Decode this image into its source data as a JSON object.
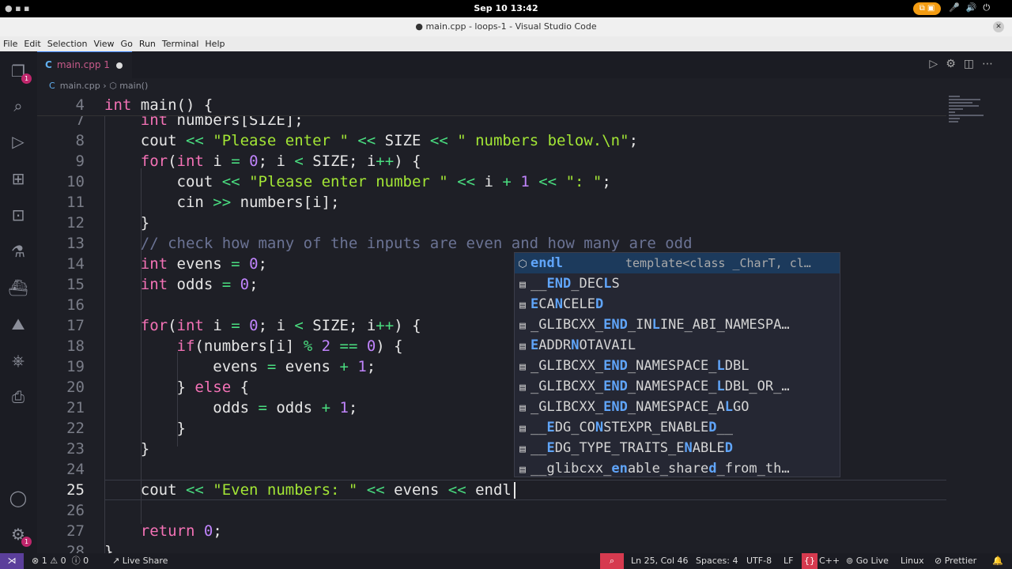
{
  "top_bar": {
    "clock": "Sep 10  13:42"
  },
  "window_title": "● main.cpp - loops-1 - Visual Studio Code",
  "menu": [
    "File",
    "Edit",
    "Selection",
    "View",
    "Go",
    "Run",
    "Terminal",
    "Help"
  ],
  "activity_badges": {
    "explorer": "1",
    "settings": "1"
  },
  "tab": {
    "lang_icon": "C",
    "label": "main.cpp 1"
  },
  "breadcrumb": {
    "file": "main.cpp",
    "symbol": "main()"
  },
  "sticky_line": {
    "number": "4",
    "text": "int main() {"
  },
  "lines": [
    {
      "n": "7",
      "t": "    int numbers[SIZE];"
    },
    {
      "n": "8",
      "t": "    cout << \"Please enter \" << SIZE << \" numbers below.\\n\";"
    },
    {
      "n": "9",
      "t": "    for(int i = 0; i < SIZE; i++) {"
    },
    {
      "n": "10",
      "t": "        cout << \"Please enter number \" << i + 1 << \": \";"
    },
    {
      "n": "11",
      "t": "        cin >> numbers[i];"
    },
    {
      "n": "12",
      "t": "    }"
    },
    {
      "n": "13",
      "t": "    // check how many of the inputs are even and how many are odd"
    },
    {
      "n": "14",
      "t": "    int evens = 0;"
    },
    {
      "n": "15",
      "t": "    int odds = 0;"
    },
    {
      "n": "16",
      "t": ""
    },
    {
      "n": "17",
      "t": "    for(int i = 0; i < SIZE; i++) {"
    },
    {
      "n": "18",
      "t": "        if(numbers[i] % 2 == 0) {"
    },
    {
      "n": "19",
      "t": "            evens = evens + 1;"
    },
    {
      "n": "20",
      "t": "        } else {"
    },
    {
      "n": "21",
      "t": "            odds = odds + 1;"
    },
    {
      "n": "22",
      "t": "        }"
    },
    {
      "n": "23",
      "t": "    }"
    },
    {
      "n": "24",
      "t": ""
    },
    {
      "n": "25",
      "t": "    cout << \"Even numbers: \" << evens << endl"
    },
    {
      "n": "26",
      "t": ""
    },
    {
      "n": "27",
      "t": "    return 0;"
    },
    {
      "n": "28",
      "t": "}"
    }
  ],
  "suggestions": [
    {
      "label": "endl",
      "detail": "template<class _CharT, cl…",
      "selected": true
    },
    {
      "label": "__END_DECLS"
    },
    {
      "label": "ECANCELED"
    },
    {
      "label": "_GLIBCXX_END_INLINE_ABI_NAMESPA…"
    },
    {
      "label": "EADDRNOTAVAIL"
    },
    {
      "label": "_GLIBCXX_END_NAMESPACE_LDBL"
    },
    {
      "label": "_GLIBCXX_END_NAMESPACE_LDBL_OR_…"
    },
    {
      "label": "_GLIBCXX_END_NAMESPACE_ALGO"
    },
    {
      "label": "__EDG_CONSTEXPR_ENABLED__"
    },
    {
      "label": "__EDG_TYPE_TRAITS_ENABLED"
    },
    {
      "label": "__glibcxx_enable_shared_from_th…"
    }
  ],
  "status": {
    "errors": "1",
    "warnings": "0",
    "info": "0",
    "live_share": "Live Share",
    "position": "Ln 25, Col 46",
    "spaces": "Spaces: 4",
    "encoding": "UTF-8",
    "eol": "LF",
    "language": "C++",
    "go_live": "Go Live",
    "os": "Linux",
    "prettier": "Prettier"
  },
  "colors": {
    "keyword": "#f472b6",
    "string": "#a3e635",
    "number": "#c084fc",
    "operator": "#4ade80",
    "comment": "#6b7394",
    "suggest_match": "#60a5fa"
  }
}
